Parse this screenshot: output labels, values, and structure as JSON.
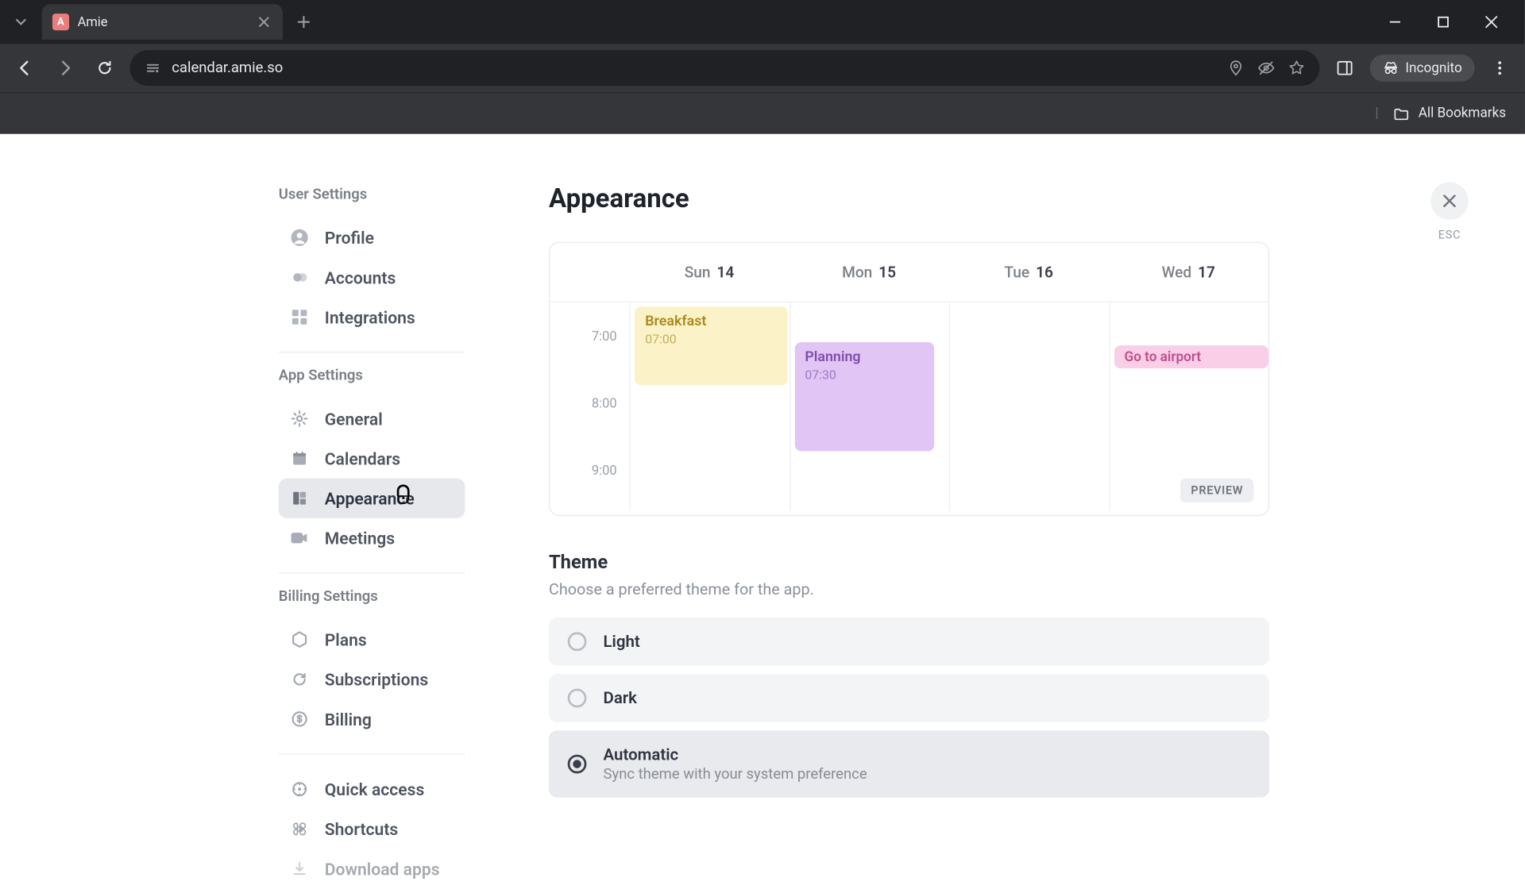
{
  "browser": {
    "tab_title": "Amie",
    "url": "calendar.amie.so",
    "incognito_label": "Incognito",
    "bookmarks_label": "All Bookmarks"
  },
  "sidebar": {
    "sections": {
      "user": {
        "title": "User Settings",
        "items": [
          "Profile",
          "Accounts",
          "Integrations"
        ]
      },
      "app": {
        "title": "App Settings",
        "items": [
          "General",
          "Calendars",
          "Appearance",
          "Meetings"
        ]
      },
      "billing": {
        "title": "Billing Settings",
        "items": [
          "Plans",
          "Subscriptions",
          "Billing"
        ]
      },
      "extra": {
        "items": [
          "Quick access",
          "Shortcuts",
          "Download apps"
        ]
      }
    },
    "active": "Appearance"
  },
  "page": {
    "title": "Appearance",
    "close_label": "ESC",
    "preview": {
      "days": [
        {
          "dow": "Sun",
          "num": "14"
        },
        {
          "dow": "Mon",
          "num": "15"
        },
        {
          "dow": "Tue",
          "num": "16"
        },
        {
          "dow": "Wed",
          "num": "17"
        }
      ],
      "times": [
        "7:00",
        "8:00",
        "9:00"
      ],
      "events": {
        "breakfast": {
          "title": "Breakfast",
          "time": "07:00"
        },
        "planning": {
          "title": "Planning",
          "time": "07:30"
        },
        "airport": {
          "title": "Go to airport"
        }
      },
      "badge": "PREVIEW"
    },
    "theme": {
      "heading": "Theme",
      "subtitle": "Choose a preferred theme for the app.",
      "options": [
        {
          "label": "Light",
          "selected": false
        },
        {
          "label": "Dark",
          "selected": false
        },
        {
          "label": "Automatic",
          "sub": "Sync theme with your system preference",
          "selected": true
        }
      ]
    }
  }
}
